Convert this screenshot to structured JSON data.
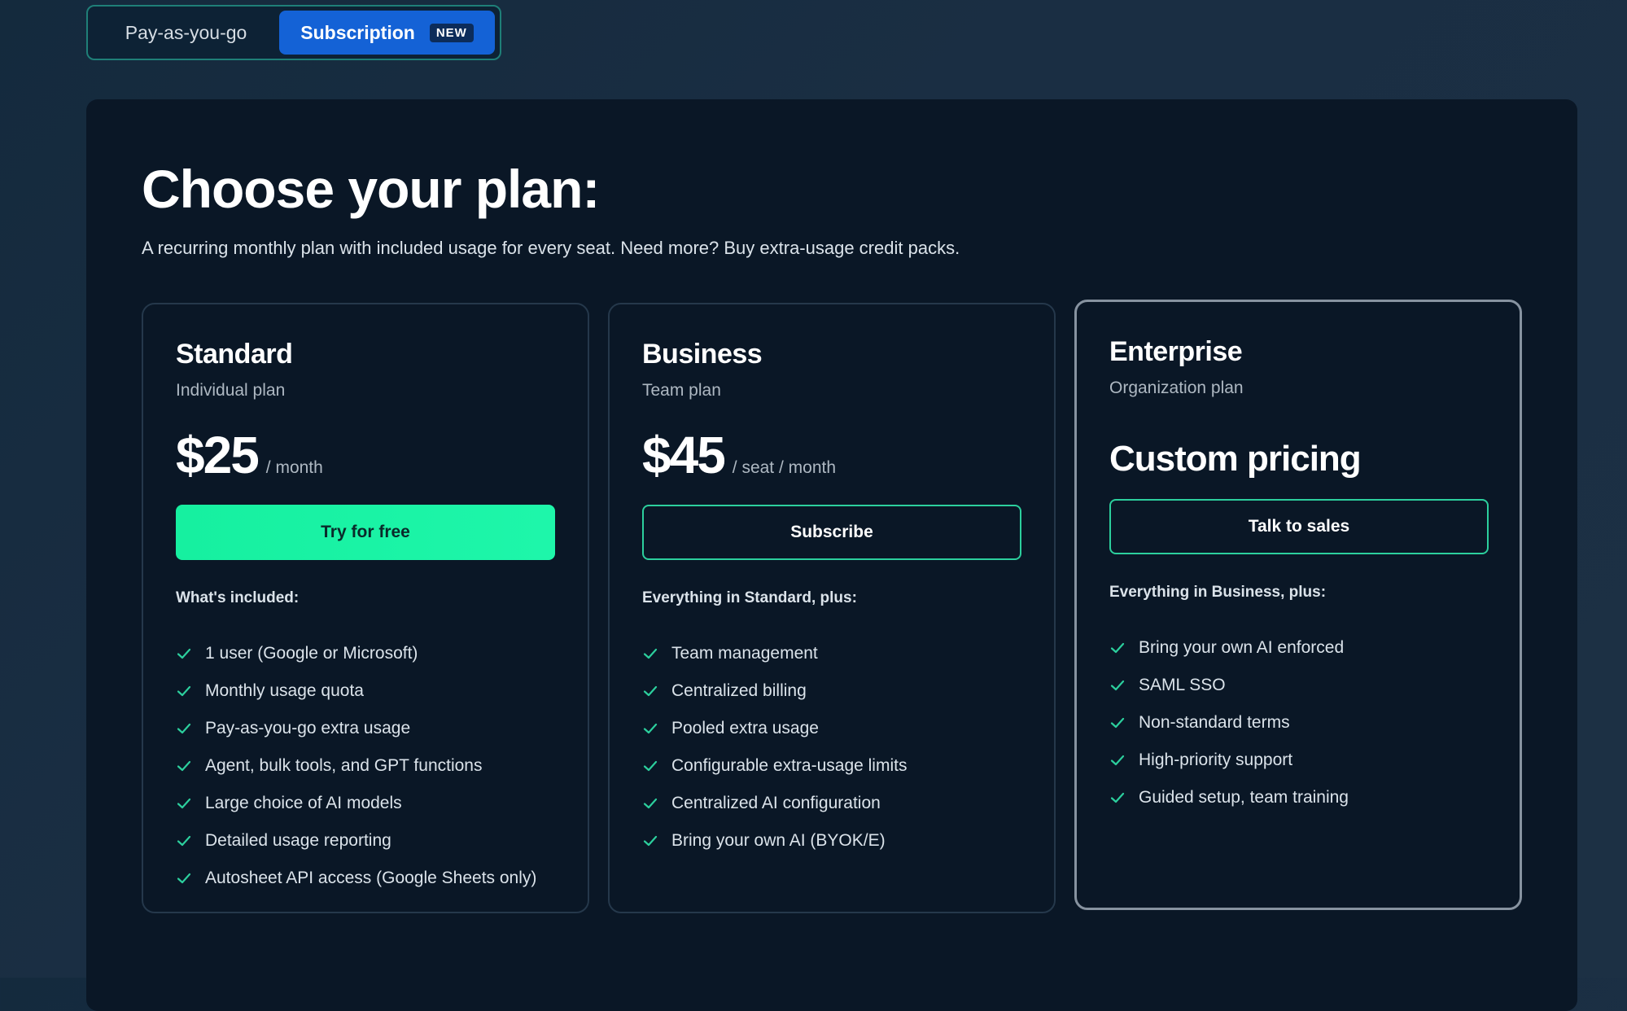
{
  "toggle": {
    "options": [
      {
        "label": "Pay-as-you-go",
        "selected": false
      },
      {
        "label": "Subscription",
        "selected": true,
        "badge": "NEW"
      }
    ]
  },
  "page": {
    "title": "Choose your plan:",
    "subtitle": "A recurring monthly plan with included usage for every seat. Need more? Buy extra-usage credit packs."
  },
  "plans": [
    {
      "name": "Standard",
      "subtitle": "Individual plan",
      "price": "$25",
      "price_unit": "/ month",
      "button_label": "Try for free",
      "button_style": "primary",
      "included_label": "What's included:",
      "features": [
        "1 user (Google or Microsoft)",
        "Monthly usage quota",
        "Pay-as-you-go extra usage",
        "Agent, bulk tools, and GPT functions",
        "Large choice of AI models",
        "Detailed usage reporting",
        "Autosheet API access (Google Sheets only)"
      ]
    },
    {
      "name": "Business",
      "subtitle": "Team plan",
      "price": "$45",
      "price_unit": "/ seat / month",
      "button_label": "Subscribe",
      "button_style": "outline",
      "included_label": "Everything in Standard, plus:",
      "features": [
        "Team management",
        "Centralized billing",
        "Pooled extra usage",
        "Configurable extra-usage limits",
        "Centralized AI configuration",
        "Bring your own AI (BYOK/E)"
      ]
    },
    {
      "name": "Enterprise",
      "subtitle": "Organization plan",
      "price": "Custom pricing",
      "button_label": "Talk to sales",
      "button_style": "outline",
      "included_label": "Everything in Business, plus:",
      "features": [
        "Bring your own AI enforced",
        "SAML SSO",
        "Non-standard terms",
        "High-priority support",
        "Guided setup, team training"
      ]
    }
  ],
  "colors": {
    "accent_green": "#1ef6aa",
    "selected_blue": "#1462d6",
    "check_color": "#2ccf9d",
    "panel_bg": "#0a1726"
  },
  "icons": {
    "feature_bullet": "check-icon"
  }
}
